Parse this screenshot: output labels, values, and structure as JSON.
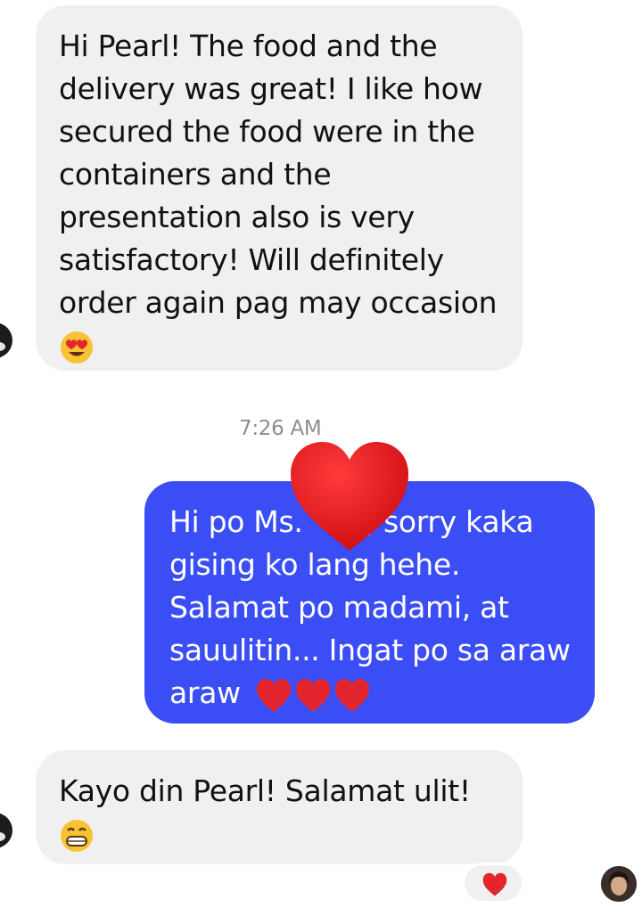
{
  "messages": [
    {
      "direction": "incoming",
      "text": "Hi Pearl! The food and the delivery was great! I like how secured the food were in the containers and the presentation also is very satisfactory! Will definitely order again pag may occasion",
      "emoji": "heart-eyes-emoji"
    },
    {
      "direction": "outgoing",
      "text_before_redaction": "Hi po Ms.",
      "text_after_redaction": ", sorry kaka gising ko lang hehe. Salamat po madami, at sauulitin... Ingat po sa araw araw",
      "emoji": "red-heart-emoji x3"
    },
    {
      "direction": "incoming",
      "text": "Kayo din Pearl! Salamat ulit!",
      "emoji": "grinning-face-emoji"
    }
  ],
  "timestamp": "7:26 AM",
  "reaction": "red-heart-emoji",
  "colors": {
    "incoming_bubble": "#f0f0f0",
    "outgoing_bubble": "#3b4ef5",
    "timestamp_text": "#8e8e8e",
    "heart": "#e3262e"
  }
}
